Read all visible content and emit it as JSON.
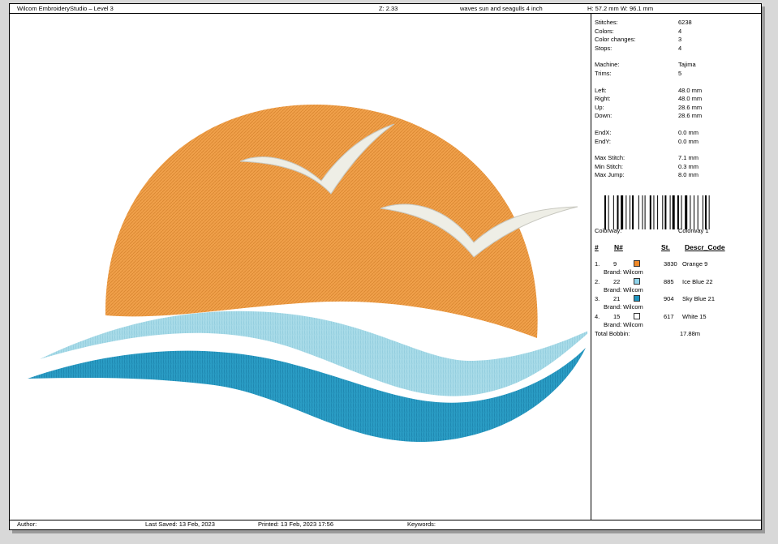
{
  "header": {
    "app_title": "Wilcom EmbroideryStudio – Level 3",
    "zoom": "Z: 2.33",
    "design_name": "waves sun and seagulls 4 inch",
    "size": "H: 57.2 mm   W: 96.1 mm"
  },
  "stats": [
    {
      "label": "Stitches:",
      "value": "6238"
    },
    {
      "label": "Colors:",
      "value": "4"
    },
    {
      "label": "Color changes:",
      "value": "3"
    },
    {
      "label": "Stops:",
      "value": "4"
    },
    {
      "label": "Machine:",
      "value": "Tajima"
    },
    {
      "label": "Trims:",
      "value": "5"
    },
    {
      "label": "Left:",
      "value": "48.0 mm"
    },
    {
      "label": "Right:",
      "value": "48.0 mm"
    },
    {
      "label": "Up:",
      "value": "28.6 mm"
    },
    {
      "label": "Down:",
      "value": "28.6 mm"
    },
    {
      "label": "EndX:",
      "value": "0.0 mm"
    },
    {
      "label": "EndY:",
      "value": "0.0 mm"
    },
    {
      "label": "Max Stitch:",
      "value": "7.1 mm"
    },
    {
      "label": "Min Stitch:",
      "value": "0.3 mm"
    },
    {
      "label": "Max Jump:",
      "value": "8.0 mm"
    }
  ],
  "colorway": {
    "label": "Colorway:",
    "value": "Colorway 1"
  },
  "color_table": {
    "headers": {
      "num": "#",
      "n": "N#",
      "st": "St.",
      "descr": "Descr_Code"
    },
    "rows": [
      {
        "idx": "1.",
        "n": "9",
        "swatch": "#f08a2a",
        "st": "3830",
        "descr": "Orange 9",
        "brand": "Brand: Wilcom"
      },
      {
        "idx": "2.",
        "n": "22",
        "swatch": "#8fd3ea",
        "st": "885",
        "descr": "Ice Blue 22",
        "brand": "Brand: Wilcom"
      },
      {
        "idx": "3.",
        "n": "21",
        "swatch": "#1f95c0",
        "st": "904",
        "descr": "Sky Blue 21",
        "brand": "Brand: Wilcom"
      },
      {
        "idx": "4.",
        "n": "15",
        "swatch": "#ffffff",
        "st": "617",
        "descr": "White 15",
        "brand": "Brand: Wilcom"
      }
    ],
    "total_label": "Total Bobbin:",
    "total_value": "17.88m"
  },
  "footer": {
    "author": "Author:",
    "last_saved": "Last Saved: 13 Feb, 2023",
    "printed": "Printed: 13 Feb, 2023 17:56",
    "keywords": "Keywords:"
  },
  "colors": {
    "sun": "#f0a04a",
    "sun_dark": "#e08a30",
    "ice_blue": "#a8dbe8",
    "sky_blue": "#2a9cc4",
    "gull": "#f0f0ea"
  }
}
